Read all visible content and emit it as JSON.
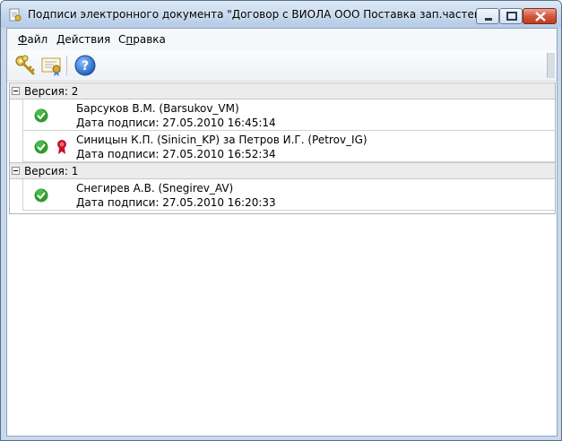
{
  "window": {
    "title": "Подписи электронного документа \"Договор с ВИОЛА ООО Поставка зап.частей\"",
    "icon": "signature-document-icon"
  },
  "menu": [
    {
      "label": "Файл"
    },
    {
      "label": "Действия"
    },
    {
      "label": "Справка"
    }
  ],
  "toolbar": {
    "buttons": [
      {
        "icon": "key-icon",
        "name": "sign"
      },
      {
        "icon": "certificate-icon",
        "name": "certificate"
      },
      {
        "icon": "help-icon",
        "name": "help"
      }
    ]
  },
  "versions": [
    {
      "label": "Версия: 2",
      "signatures": [
        {
          "signer": "Барсуков В.М. (Barsukov_VM)",
          "date": "Дата подписи: 27.05.2010 16:45:14",
          "status_icon": "valid-check-icon",
          "proxy": false
        },
        {
          "signer": "Синицын К.П. (Sinicin_KP) за Петров И.Г. (Petrov_IG)",
          "date": "Дата подписи: 27.05.2010 16:52:34",
          "status_icon": "valid-check-icon",
          "proxy": true
        }
      ]
    },
    {
      "label": "Версия: 1",
      "signatures": [
        {
          "signer": "Снегирев А.В. (Snegirev_AV)",
          "date": "Дата подписи: 27.05.2010 16:20:33",
          "status_icon": "valid-check-icon",
          "proxy": false
        }
      ]
    }
  ],
  "colors": {
    "valid": "#2e9c2e",
    "seal": "#c8102e",
    "group_bg": "#ececec"
  }
}
